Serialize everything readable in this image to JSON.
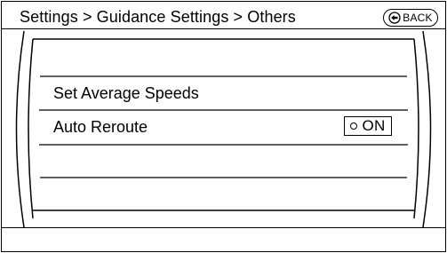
{
  "header": {
    "breadcrumb": "Settings > Guidance Settings > Others",
    "back_label": "BACK",
    "back_icon": "back-arrow-icon"
  },
  "list": {
    "items": [
      {
        "label": "Set Average Speeds"
      },
      {
        "label": "Auto Reroute",
        "toggle": {
          "label": "ON",
          "state": "off"
        }
      }
    ]
  }
}
